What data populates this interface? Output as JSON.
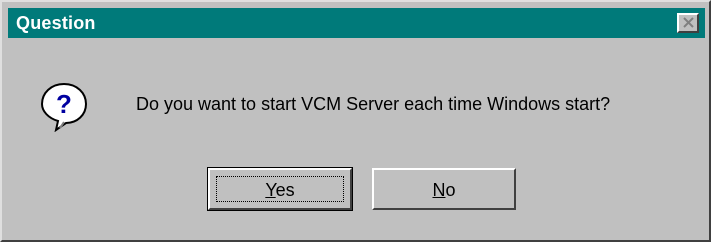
{
  "window": {
    "title": "Question",
    "titlebar_color": "#007a7a",
    "face_color": "#c0c0c0",
    "close_icon": "close-x"
  },
  "icon": {
    "name": "question-icon",
    "glyph": "?"
  },
  "message": "Do you want to start VCM Server each time Windows start?",
  "buttons": {
    "yes": {
      "mnemonic": "Y",
      "rest": "es"
    },
    "no": {
      "mnemonic": "N",
      "rest": "o"
    }
  }
}
